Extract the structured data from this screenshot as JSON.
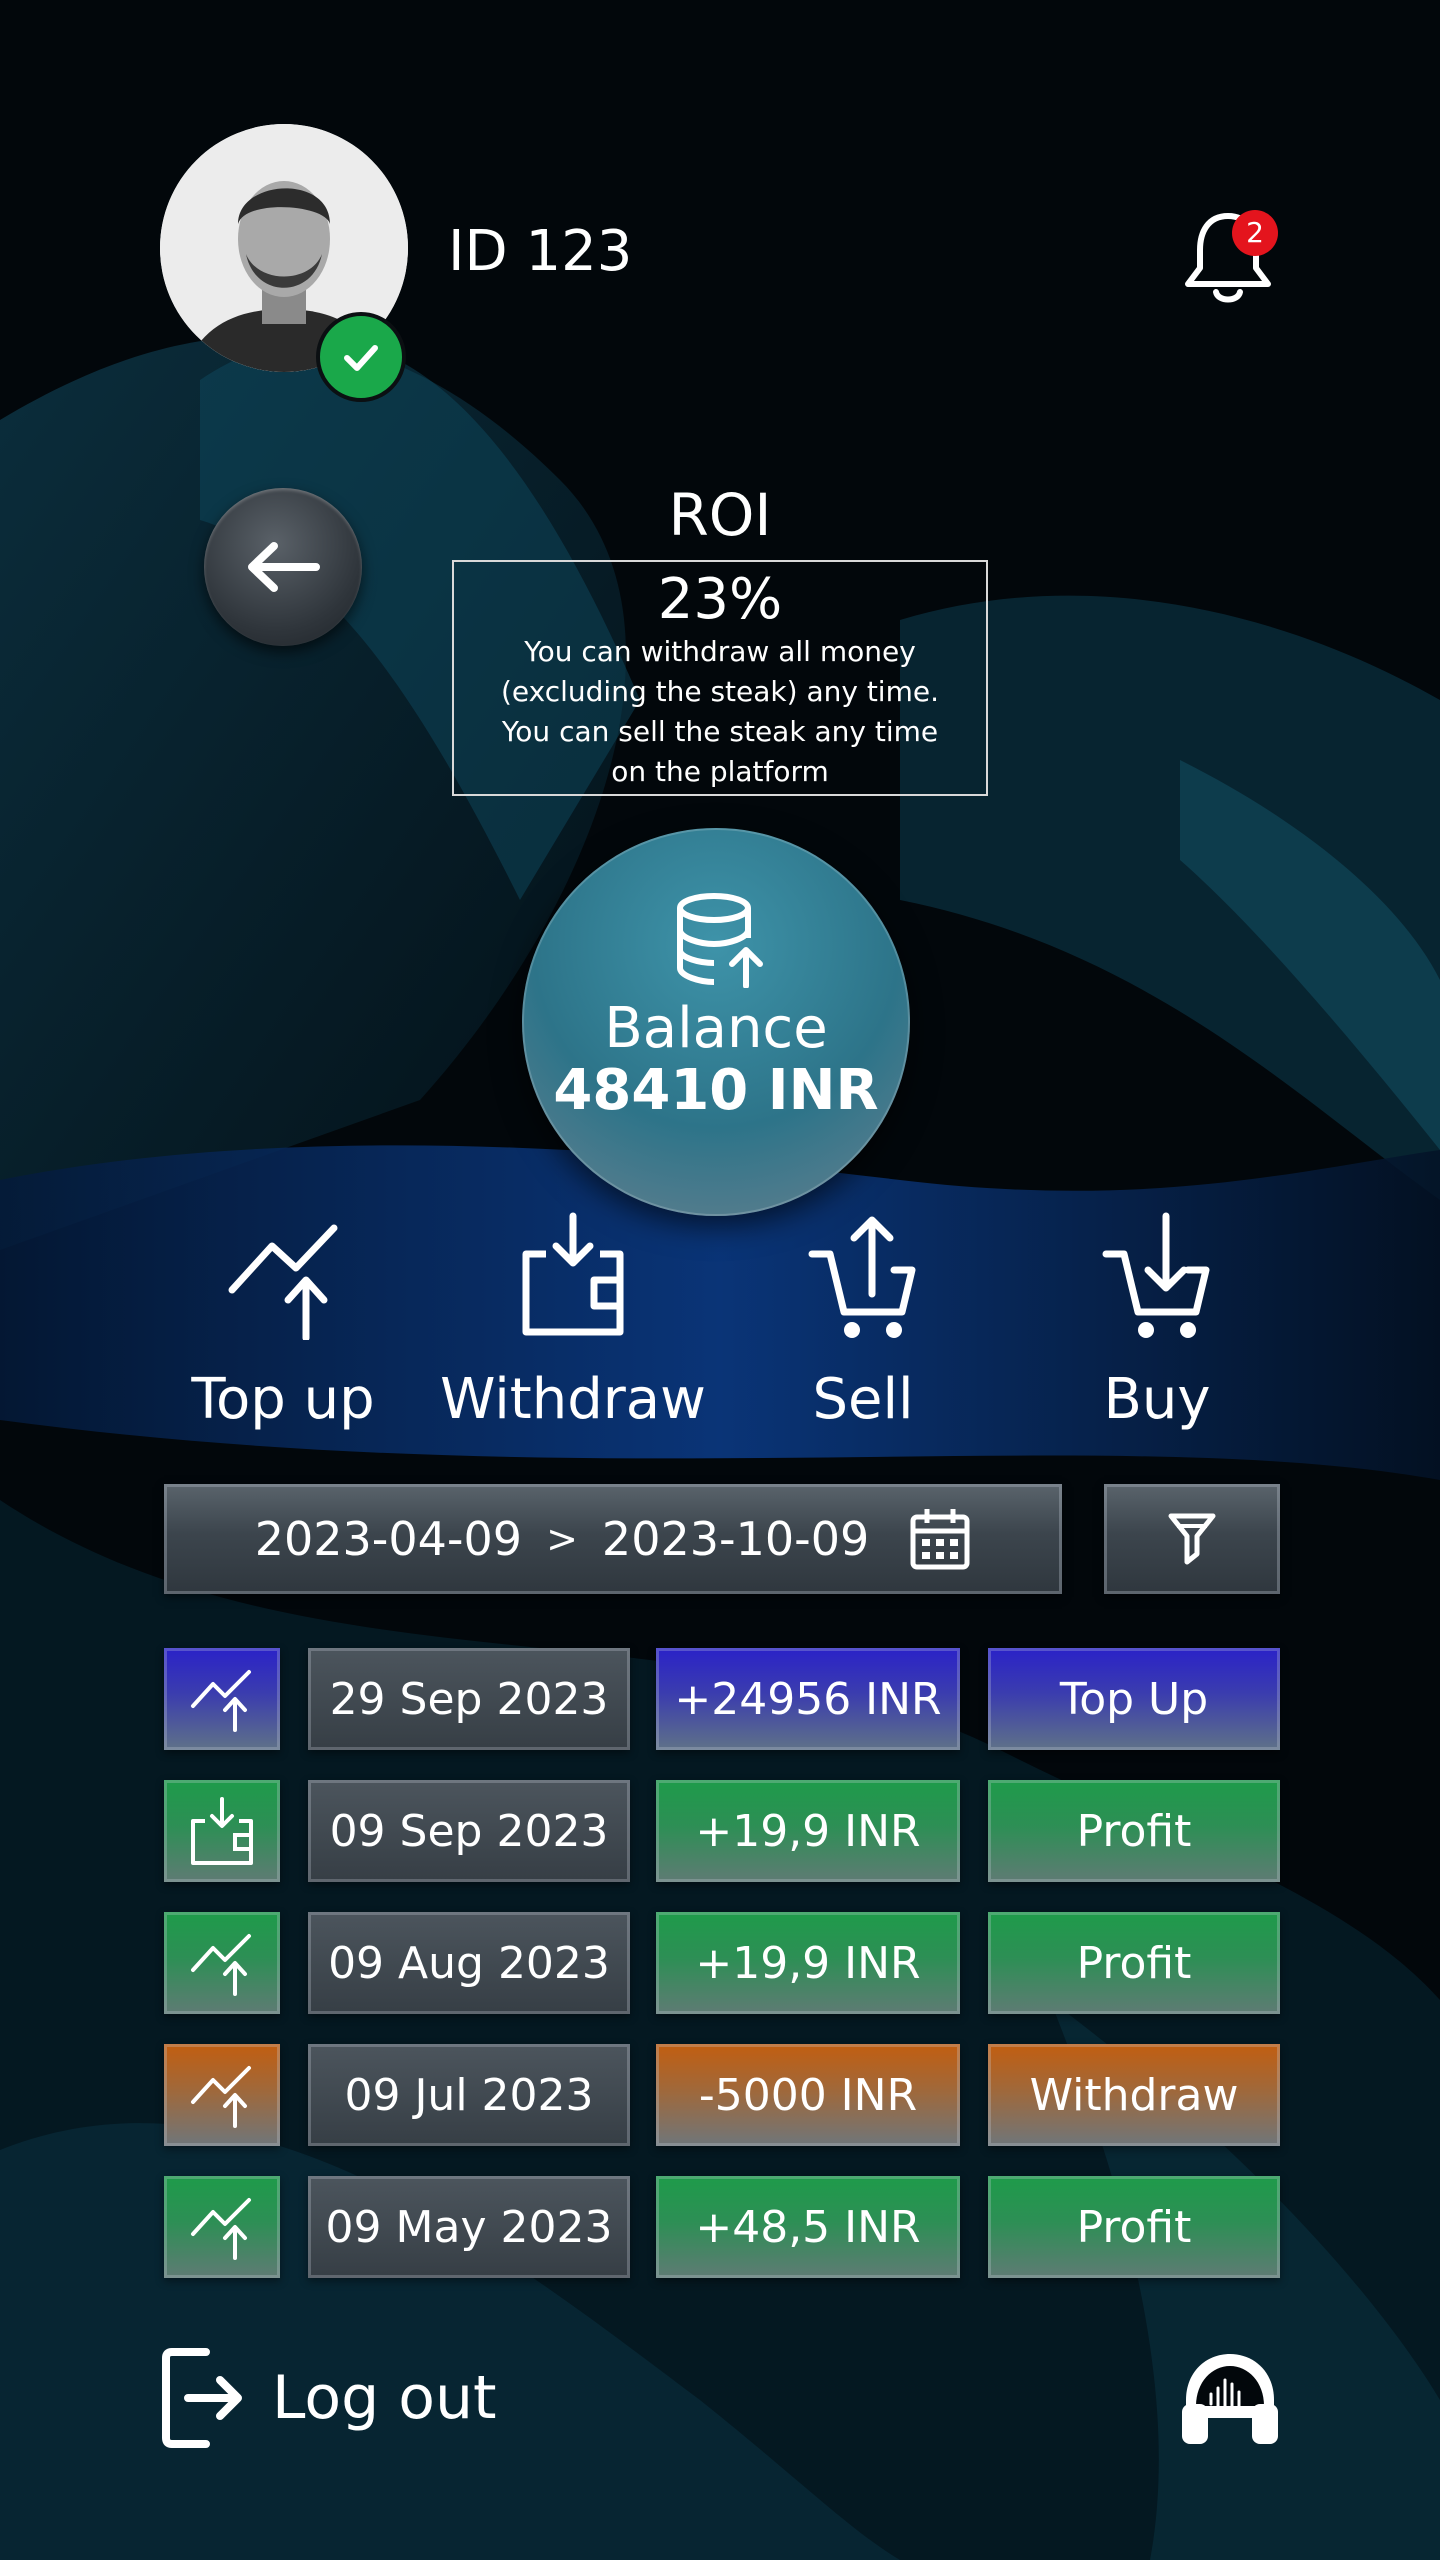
{
  "header": {
    "user_id": "ID 123",
    "notification_count": "2",
    "verified": true,
    "avatar_icon": "user-photo"
  },
  "roi": {
    "title": "ROI",
    "value": "23%",
    "note": "You can withdraw all money (excluding the steak) any time. You can sell the steak any time on the platform"
  },
  "balance": {
    "label": "Balance",
    "amount": "48410 INR",
    "icon": "database-upload-icon"
  },
  "actions": [
    {
      "label": "Top up",
      "icon": "trend-up-icon"
    },
    {
      "label": "Withdraw",
      "icon": "wallet-download-icon"
    },
    {
      "label": "Sell",
      "icon": "cart-upload-icon"
    },
    {
      "label": "Buy",
      "icon": "cart-download-icon"
    }
  ],
  "date_range": {
    "from": "2023-04-09",
    "separator": ">",
    "to": "2023-10-09"
  },
  "transactions": [
    {
      "date": "29 Sep 2023",
      "amount": "+24956 INR",
      "type": "Top Up",
      "color": "#2a22c8",
      "icon": "trend-up-icon"
    },
    {
      "date": "09 Sep 2023",
      "amount": "+19,9 INR",
      "type": "Profit",
      "color": "#1e9b4a",
      "icon": "wallet-download-icon"
    },
    {
      "date": "09 Aug 2023",
      "amount": "+19,9 INR",
      "type": "Profit",
      "color": "#1e9b4a",
      "icon": "trend-up-icon"
    },
    {
      "date": "09 Jul 2023",
      "amount": "-5000 INR",
      "type": "Withdraw",
      "color": "#c25e10",
      "icon": "trend-up-icon"
    },
    {
      "date": "09 May 2023",
      "amount": "+48,5 INR",
      "type": "Profit",
      "color": "#1e9b4a",
      "icon": "trend-up-icon"
    }
  ],
  "footer": {
    "logout_label": "Log out",
    "support_icon": "headphones-icon"
  }
}
